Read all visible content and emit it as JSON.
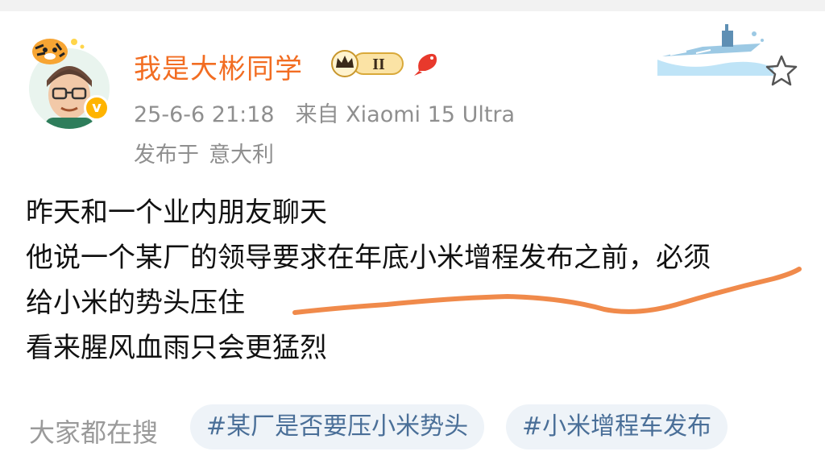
{
  "post": {
    "author": "我是大彬同学",
    "vip_level": "II",
    "timestamp": "25-6-6 21:18",
    "source": "来自 Xiaomi 15 Ultra",
    "location_prefix": "发布于",
    "location": "意大利",
    "verified_mark": "v",
    "lines": [
      "昨天和一个业内朋友聊天",
      "他说一个某厂的领导要求在年底小米增程发布之前，必须",
      "给小米的势头压住",
      "看来腥风血雨只会更猛烈"
    ]
  },
  "search": {
    "label": "大家都在搜",
    "topics": [
      "#某厂是否要压小米势头",
      "#小米增程车发布"
    ]
  },
  "icons": {
    "favorite": "star-outline-icon",
    "verified": "verified-v-icon",
    "vip": "crown-vip-badge-icon",
    "fish": "koi-fish-icon",
    "decoration": "aircraft-carrier-decoration"
  },
  "colors": {
    "author": "#f26d22",
    "meta": "#8f8f8f",
    "body": "#111111",
    "annotation": "#f08a4b",
    "chip_bg": "#eef3f8",
    "chip_text": "#4a6f98"
  }
}
